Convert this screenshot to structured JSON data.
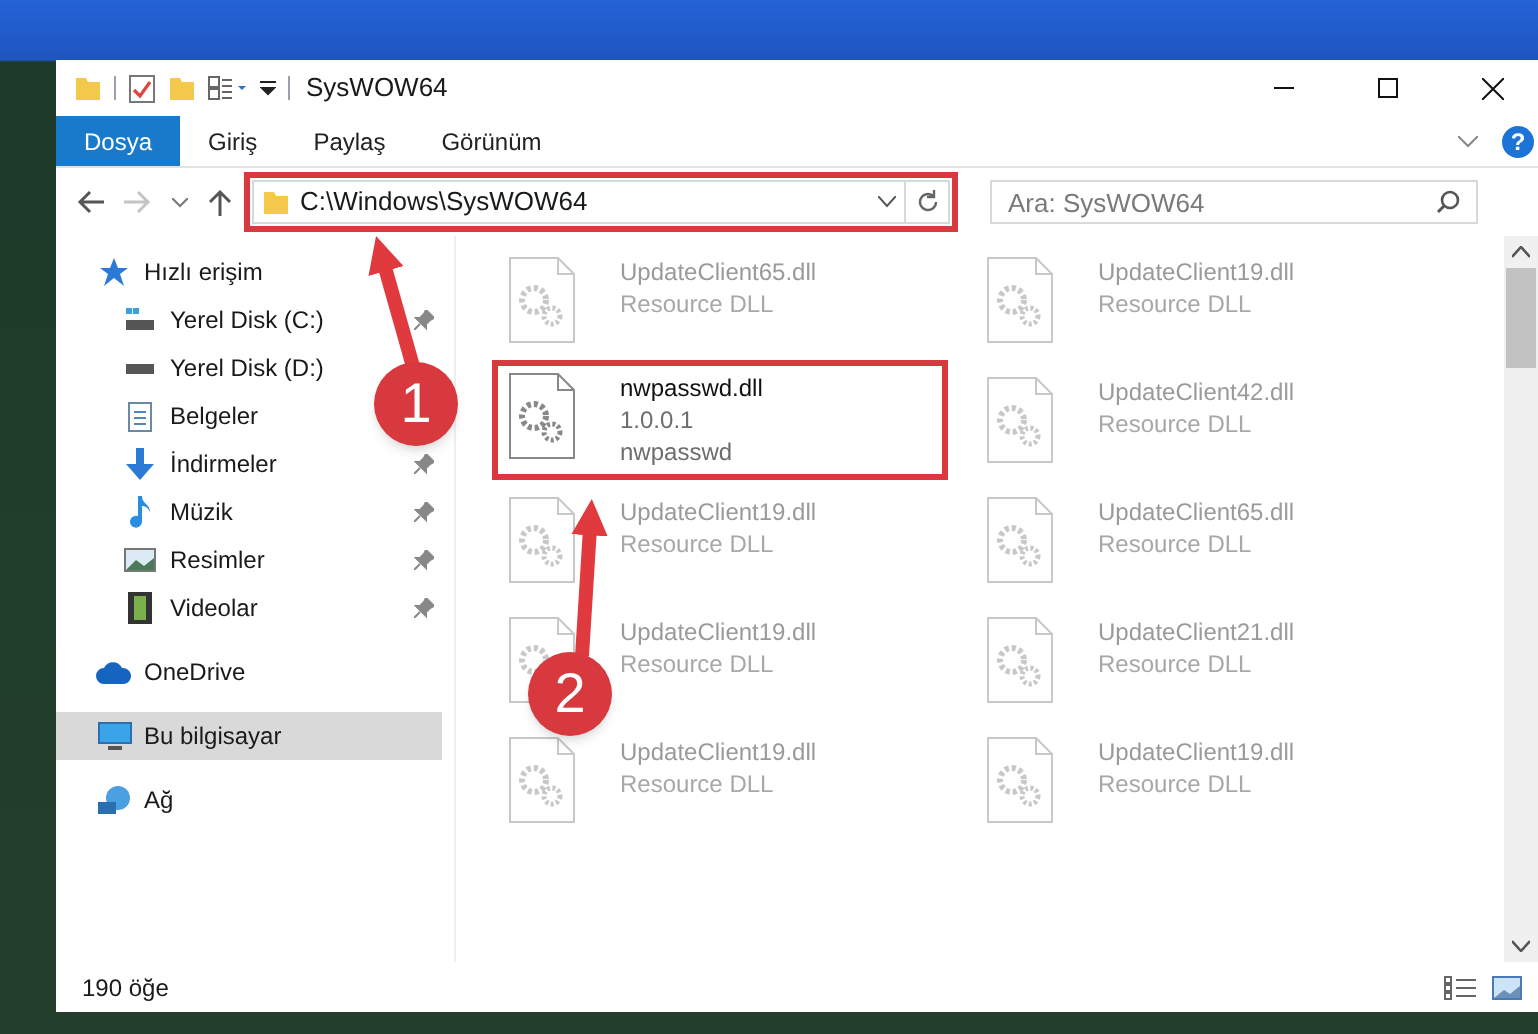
{
  "window": {
    "title": "SysWOW64"
  },
  "ribbon_tabs": [
    {
      "label": "Dosya",
      "selected": true
    },
    {
      "label": "Giriş",
      "selected": false
    },
    {
      "label": "Paylaş",
      "selected": false
    },
    {
      "label": "Görünüm",
      "selected": false
    }
  ],
  "help_button": {
    "label": "?"
  },
  "address_bar": {
    "value": "C:\\Windows\\SysWOW64",
    "highlighted": true
  },
  "search": {
    "placeholder": "Ara: SysWOW64"
  },
  "sidebar": {
    "items": [
      {
        "label": "Hızlı erişim",
        "selected": false,
        "pinned": false,
        "children": [
          {
            "label": "Yerel Disk (C:)",
            "selected": false,
            "pinned": true
          },
          {
            "label": "Yerel Disk (D:)",
            "selected": false,
            "pinned": false
          },
          {
            "label": "Belgeler",
            "selected": false,
            "pinned": false
          },
          {
            "label": "İndirmeler",
            "selected": false,
            "pinned": true
          },
          {
            "label": "Müzik",
            "selected": false,
            "pinned": true
          },
          {
            "label": "Resimler",
            "selected": false,
            "pinned": true
          },
          {
            "label": "Videolar",
            "selected": false,
            "pinned": true
          }
        ]
      },
      {
        "label": "OneDrive",
        "selected": false,
        "pinned": false
      },
      {
        "label": "Bu bilgisayar",
        "selected": true,
        "pinned": false
      },
      {
        "label": "Ağ",
        "selected": false,
        "pinned": false
      }
    ]
  },
  "files": [
    {
      "name": "UpdateClient65.dll",
      "lines": [
        "Resource DLL"
      ],
      "blurred": true,
      "highlighted": false
    },
    {
      "name": "UpdateClient19.dll",
      "lines": [
        "Resource DLL"
      ],
      "blurred": true,
      "highlighted": false
    },
    {
      "name": "nwpasswd.dll",
      "lines": [
        "1.0.0.1",
        "nwpasswd"
      ],
      "blurred": false,
      "highlighted": true
    },
    {
      "name": "UpdateClient42.dll",
      "lines": [
        "Resource DLL"
      ],
      "blurred": true,
      "highlighted": false
    },
    {
      "name": "UpdateClient19.dll",
      "lines": [
        "Resource DLL"
      ],
      "blurred": true,
      "highlighted": false
    },
    {
      "name": "UpdateClient65.dll",
      "lines": [
        "Resource DLL"
      ],
      "blurred": true,
      "highlighted": false
    },
    {
      "name": "UpdateClient19.dll",
      "lines": [
        "Resource DLL"
      ],
      "blurred": true,
      "highlighted": false
    },
    {
      "name": "UpdateClient21.dll",
      "lines": [
        "Resource DLL"
      ],
      "blurred": true,
      "highlighted": false
    },
    {
      "name": "UpdateClient19.dll",
      "lines": [
        "Resource DLL"
      ],
      "blurred": true,
      "highlighted": false
    },
    {
      "name": "UpdateClient19.dll",
      "lines": [
        "Resource DLL"
      ],
      "blurred": true,
      "highlighted": false
    }
  ],
  "status_bar": {
    "item_count": "190 öğe"
  },
  "annotations": [
    {
      "number": "1"
    },
    {
      "number": "2"
    }
  ]
}
